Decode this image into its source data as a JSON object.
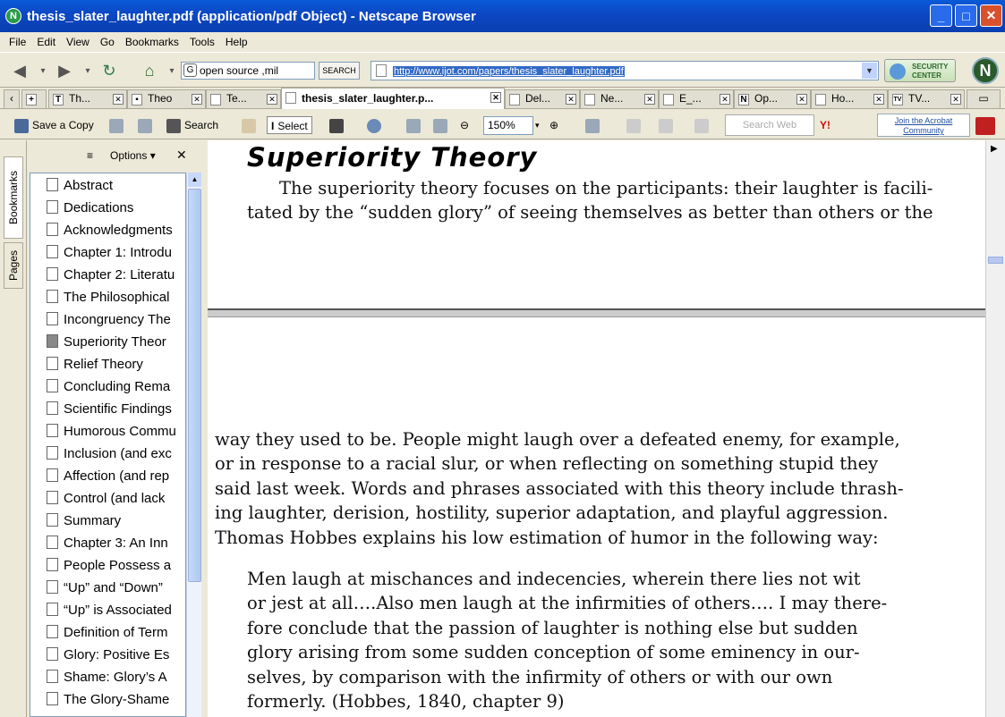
{
  "window": {
    "title": "thesis_slater_laughter.pdf (application/pdf Object) - Netscape Browser",
    "min_label": "_",
    "max_label": "□",
    "close_label": "✕"
  },
  "menu": {
    "file": "File",
    "edit": "Edit",
    "view": "View",
    "go": "Go",
    "bookmarks": "Bookmarks",
    "tools": "Tools",
    "help": "Help"
  },
  "nav": {
    "search_value": "open source ,mil",
    "search_button": "SEARCH",
    "url": "http://www.ijot.com/papers/thesis_slater_laughter.pdf",
    "security_line1": "SECURITY",
    "security_line2": "CENTER",
    "logo_letter": "N"
  },
  "tabs": [
    {
      "label": "Th...",
      "icon": "T"
    },
    {
      "label": "Theo",
      "icon": "▪"
    },
    {
      "label": "Te...",
      "icon": ""
    },
    {
      "label": "thesis_slater_laughter.p...",
      "icon": ""
    },
    {
      "label": "Del...",
      "icon": ""
    },
    {
      "label": "Ne...",
      "icon": ""
    },
    {
      "label": "E_...",
      "icon": ""
    },
    {
      "label": "Op...",
      "icon": "N"
    },
    {
      "label": "Ho...",
      "icon": ""
    },
    {
      "label": "TV...",
      "icon": "TV"
    }
  ],
  "acrobat": {
    "save_copy": "Save a Copy",
    "search": "Search",
    "select": "Select",
    "zoom": "150%",
    "search_web": "Search Web",
    "community_line1": "Join the Acrobat",
    "community_line2": "Community"
  },
  "sidebar": {
    "tab_bookmarks": "Bookmarks",
    "tab_pages": "Pages",
    "options_label": "Options",
    "close_label": "✕",
    "items": [
      "Abstract",
      "Dedications",
      "Acknowledgments",
      "Chapter 1: Introdu",
      "Chapter 2: Literatu",
      "The Philosophical",
      "Incongruency The",
      "Superiority Theor",
      "Relief Theory",
      "Concluding Rema",
      "Scientific Findings",
      "Humorous Commu",
      "Inclusion (and exc",
      "Affection (and rep",
      "Control (and lack",
      "Summary",
      "Chapter 3: An Inn",
      "People Possess a",
      "“Up” and “Down”",
      "“Up” is Associated",
      "Definition of Term",
      "Glory: Positive Es",
      "Shame: Glory’s A",
      "The Glory-Shame"
    ]
  },
  "document": {
    "heading": "Superiority Theory",
    "para1_line1": "The superiority theory focuses on the participants: their laughter is facili-",
    "para1_line2": "tated by the “sudden glory” of seeing themselves as better than others or the",
    "para2": [
      "way they used to be. People might laugh over a defeated enemy, for example,",
      "or in response to a racial slur, or when reflecting on something stupid they",
      "said last week. Words and phrases associated with this theory include thrash-",
      "ing laughter, derision, hostility, superior adaptation, and playful aggression.",
      "Thomas Hobbes explains his low estimation of humor in the following way:"
    ],
    "quote": [
      "Men laugh at mischances and indecencies, wherein there lies not wit",
      "or jest at all….Also men laugh at the infirmities of others…. I may there-",
      "fore conclude that the passion of laughter is nothing else but sudden",
      "glory arising from some sudden conception of some eminency in our-",
      "selves, by comparison with the infirmity of others or with our own",
      "formerly. (Hobbes, 1840, chapter 9)"
    ]
  }
}
